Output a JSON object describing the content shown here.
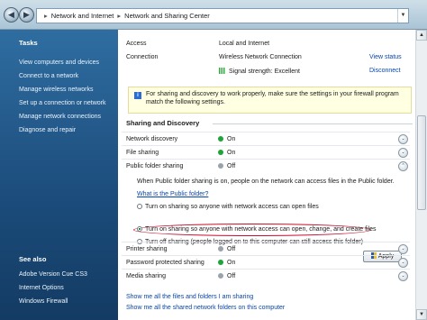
{
  "nav": {
    "back": "◀",
    "forward": "▶"
  },
  "address": {
    "part1": "Network and Internet",
    "part2": "Network and Sharing Center",
    "sep": "▸"
  },
  "sidebar": {
    "tasks_heading": "Tasks",
    "tasks": [
      "View computers and devices",
      "Connect to a network",
      "Manage wireless networks",
      "Set up a connection or network",
      "Manage network connections",
      "Diagnose and repair"
    ],
    "see_also_heading": "See also",
    "see_also": [
      "Adobe Version Cue CS3",
      "Internet Options",
      "Windows Firewall"
    ]
  },
  "connection": {
    "access_label": "Access",
    "access_value": "Local and Internet",
    "conn_label": "Connection",
    "conn_value": "Wireless Network Connection",
    "view_status": "View status",
    "signal": "Signal strength: Excellent",
    "disconnect": "Disconnect"
  },
  "info_text": "For sharing and discovery to work properly, make sure the settings in your firewall program match the following settings.",
  "section_title": "Sharing and Discovery",
  "rows_top": [
    {
      "label": "Network discovery",
      "status": "On",
      "color": "#1fa33a",
      "chev": "⌄"
    },
    {
      "label": "File sharing",
      "status": "On",
      "color": "#1fa33a",
      "chev": "⌄"
    },
    {
      "label": "Public folder sharing",
      "status": "Off",
      "color": "#9aa3ab",
      "chev": "⌃"
    }
  ],
  "public": {
    "desc": "When Public folder sharing is on, people on the network can access files in the Public folder.",
    "what_link": "What is the Public folder?",
    "opt1": "Turn on sharing so anyone with network access can open files",
    "opt2": "Turn on sharing so anyone with network access can open, change, and create files",
    "opt3": "Turn off sharing (people logged on to this computer can still access this folder)",
    "apply": "Apply"
  },
  "rows_bottom": [
    {
      "label": "Printer sharing",
      "status": "Off",
      "color": "#9aa3ab",
      "chev": "⌄"
    },
    {
      "label": "Password protected sharing",
      "status": "On",
      "color": "#1fa33a",
      "chev": "⌄"
    },
    {
      "label": "Media sharing",
      "status": "Off",
      "color": "#9aa3ab",
      "chev": "⌄"
    }
  ],
  "links": [
    "Show me all the files and folders I am sharing",
    "Show me all the shared network folders on this computer"
  ],
  "icons": {
    "scroll_up": "▲",
    "scroll_down": "▼",
    "info": "i",
    "dropdown": "▼"
  }
}
